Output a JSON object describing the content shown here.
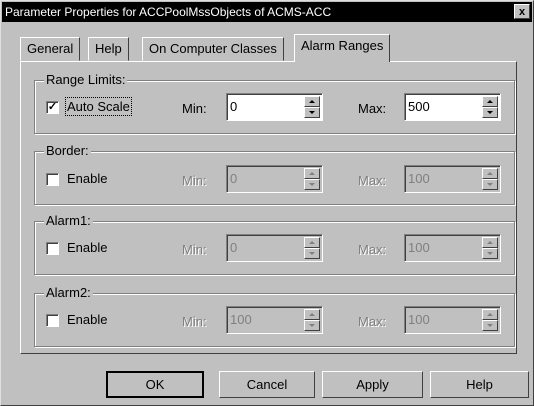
{
  "window": {
    "title": "Parameter Properties for ACCPoolMssObjects of ACMS-ACC",
    "close_label": "x"
  },
  "tabs": [
    {
      "label": "General",
      "active": false
    },
    {
      "label": "Help",
      "active": false
    },
    {
      "label": "On Computer Classes",
      "active": false
    },
    {
      "label": "Alarm Ranges",
      "active": true
    }
  ],
  "groups": {
    "range_limits": {
      "title": "Range Limits:",
      "checkbox_label": "Auto Scale",
      "checked": true,
      "enabled": true,
      "min_label": "Min:",
      "min_value": "0",
      "max_label": "Max:",
      "max_value": "500"
    },
    "border": {
      "title": "Border:",
      "checkbox_label": "Enable",
      "checked": false,
      "enabled": false,
      "min_label": "Min:",
      "min_value": "0",
      "max_label": "Max:",
      "max_value": "100"
    },
    "alarm1": {
      "title": "Alarm1:",
      "checkbox_label": "Enable",
      "checked": false,
      "enabled": false,
      "min_label": "Min:",
      "min_value": "0",
      "max_label": "Max:",
      "max_value": "100"
    },
    "alarm2": {
      "title": "Alarm2:",
      "checkbox_label": "Enable",
      "checked": false,
      "enabled": false,
      "min_label": "Min:",
      "min_value": "100",
      "max_label": "Max:",
      "max_value": "100"
    }
  },
  "buttons": {
    "ok": "OK",
    "cancel": "Cancel",
    "apply": "Apply",
    "help": "Help"
  },
  "colors": {
    "face": "#c0c0c0",
    "titlebar": "#000000",
    "disabled_text": "#808080"
  }
}
